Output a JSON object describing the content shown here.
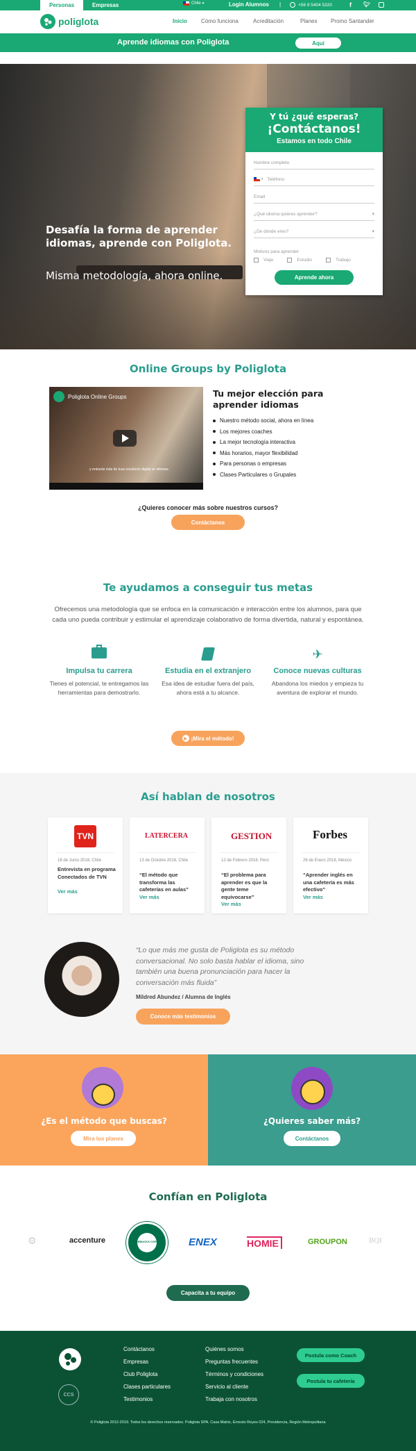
{
  "topbar": {
    "tab_personas": "Personas",
    "tab_empresas": "Empresas",
    "country": "Chile",
    "login": "Login Alumnos",
    "separator": "|",
    "phone": "+56 9 5404 5320"
  },
  "nav": {
    "brand": "poliglota",
    "links": [
      "Inicio",
      "Cómo funciona",
      "Acreditación",
      "Planes",
      "Promo Santander"
    ]
  },
  "banner": {
    "text": "Aprende idiomas con Poliglota",
    "button": "Aquí"
  },
  "hero": {
    "headline": "Desafía la forma de aprender idiomas, aprende con Poliglota.",
    "subline": "Misma metodología, ahora online."
  },
  "form": {
    "eyebrow": "Y tú ¿qué esperas?",
    "title": "¡Contáctanos!",
    "subtitle": "Estamos en todo Chile",
    "name_placeholder": "Nombre completo",
    "phone_placeholder": "Teléfono",
    "email_placeholder": "Email",
    "language_select": "¿Qué idioma quieres aprender?",
    "origin_select": "¿De dónde eres?",
    "motivation_label": "Motivos para aprender",
    "motivations": [
      "Viaje",
      "Estudio",
      "Trabajo"
    ],
    "submit": "Aprende ahora"
  },
  "online": {
    "title": "Online Groups by Poliglota",
    "video_title": "Poliglota Online Groups",
    "video_caption": "y entrarás más de tuus recuiticón digital en idiomas",
    "heading": "Tu mejor elección para aprender idiomas",
    "bullets": [
      "Nuestro método social, ahora en línea",
      "Los mejores coaches",
      "La mejor tecnología interactiva",
      "Más horarios, mayor flexibilidad",
      "Para personas o empresas",
      "Clases Particulares o Grupales"
    ],
    "question": "¿Quieres conocer más sobre nuestros cursos?",
    "button": "Contáctanos"
  },
  "goals": {
    "title": "Te ayudamos a conseguir tus metas",
    "intro": "Ofrecemos una metodología que se enfoca en la comunicación e interacción entre los alumnos, para que cada uno pueda contribuir y estimular el aprendizaje colaborativo de forma divertida, natural y espontánea.",
    "cols": [
      {
        "title": "Impulsa tu carrera",
        "text": "Tienes el potencial, te entregamos las herramientas para demostrarlo.",
        "icon": "briefcase-icon"
      },
      {
        "title": "Estudia en el extranjero",
        "text": "Esa idea de estudiar fuera del país, ahora está a tu alcance.",
        "icon": "book-icon"
      },
      {
        "title": "Conoce nuevas culturas",
        "text": "Abandona los miedos y empieza tu aventura de explorar el mundo.",
        "icon": "plane-icon"
      }
    ],
    "button": "¡Mira el método!"
  },
  "press": {
    "title": "Así hablan de nosotros",
    "cards": [
      {
        "logo": "TVN",
        "meta": "18 de Junio 2018, Chile",
        "title": "Entrevista en programa Conectados de TVN",
        "more": "Ver más"
      },
      {
        "logo": "LATERCERA",
        "meta": "13 de Octubre 2016, Chile",
        "title": "“El método que transforma las cafeterías en aulas”",
        "more": "Ver más"
      },
      {
        "logo": "GESTION",
        "meta": "12 de Febrero 2016, Perú",
        "title": "“El problema para aprender es que la gente teme equivocarse”",
        "more": "Ver más"
      },
      {
        "logo": "Forbes",
        "meta": "26 de Enero 2018, México",
        "title": "“Aprender inglés en una cafetería es más efectivo”",
        "more": "Ver más"
      }
    ],
    "quote": "“Lo que más me gusta de Poliglota es su método conversacional. No solo basta hablar el idioma, sino también una buena pronunciación para hacer la conversación más fluida”",
    "author": "Mildred Abundez / Alumna de Inglés",
    "button": "Conoce más testimonios"
  },
  "cta": {
    "left_title": "¿Es el método que buscas?",
    "left_button": "Mira los planes",
    "right_title": "¿Quieres saber más?",
    "right_button": "Contáctanos"
  },
  "trust": {
    "title": "Confían en Poliglota",
    "logos": [
      "accenture",
      "STARBUCKS COFFEE",
      "ENEX",
      "HOMIE",
      "GROUPON",
      "BQI"
    ],
    "button": "Capacita a tu equipo"
  },
  "footer": {
    "col1": [
      "Contáctanos",
      "Empresas",
      "Club Poliglota",
      "Clases particulares",
      "Testimonios"
    ],
    "col2": [
      "Quiénes somos",
      "Preguntas frecuentes",
      "Términos y condiciones",
      "Servicio al cliente",
      "Trabaja con nosotros"
    ],
    "btn1": "Postula como Coach",
    "btn2": "Postula tu cafetería",
    "ccs": "CCS",
    "copyright": "© Poliglota 2012-2019. Todos los derechos reservados. Poliglota SPA. Casa Matriz, Ernesto Reyes 024, Providencia, Región Metropolitana"
  },
  "colors": {
    "green": "#1aa874",
    "teal": "#2a9d8f",
    "orange": "#f7a35c",
    "dark_green": "#0b5234"
  }
}
